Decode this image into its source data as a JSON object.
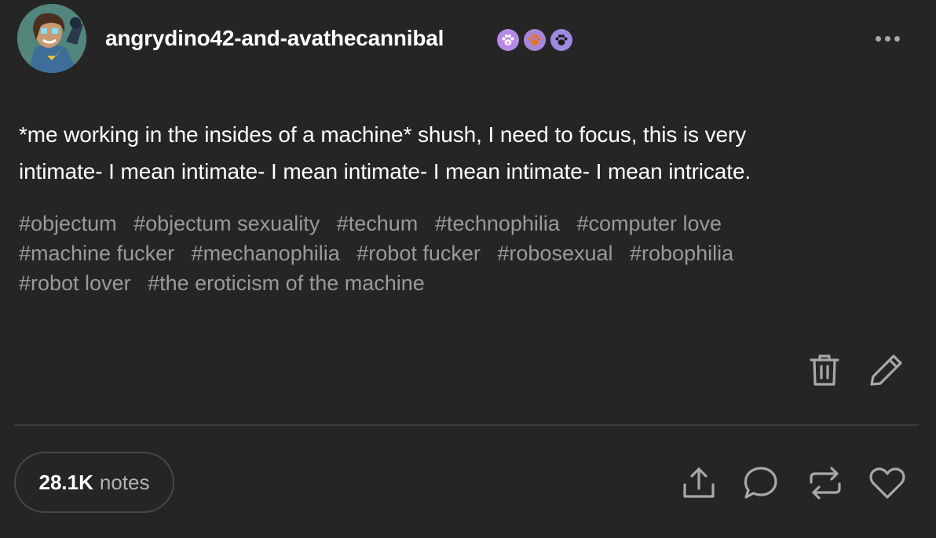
{
  "post": {
    "author": "angrydino42-and-avathecannibal",
    "badges": [
      {
        "icon": "pink-paw-badge-icon",
        "bg": "#b58ae6",
        "fg": "#ffffff"
      },
      {
        "icon": "orange-paw-badge-icon",
        "bg": "#a884d6",
        "fg": "#e8731a"
      },
      {
        "icon": "black-paw-badge-icon",
        "bg": "#9e8ae0",
        "fg": "#1c1c1c"
      }
    ],
    "body_line_1": "*me working in the insides of a machine* shush, I need to focus, this is very",
    "body_line_2": "intimate- I mean intimate- I mean intimate- I mean intimate- I mean intricate.",
    "tags": [
      "#objectum",
      "#objectum sexuality",
      "#techum",
      "#technophilia",
      "#computer love",
      "#machine fucker",
      "#mechanophilia",
      "#robot fucker",
      "#robosexual",
      "#robophilia",
      "#robot lover",
      "#the eroticism of the machine"
    ],
    "notes_count": "28.1K",
    "notes_label": "notes"
  },
  "colors": {
    "background": "#252525",
    "text": "#ffffff",
    "tag_text": "#9a9a9a",
    "icon": "#a8a8a8"
  }
}
